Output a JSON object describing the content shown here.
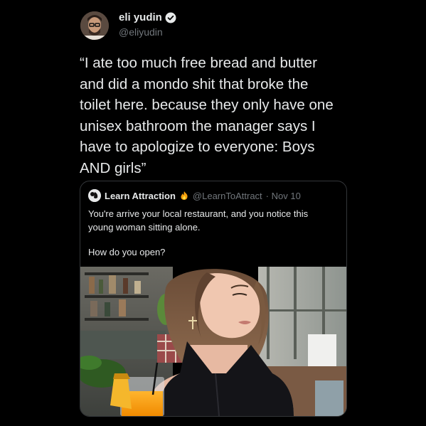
{
  "tweet": {
    "author_name": "eli yudin",
    "author_handle": "@eliyudin",
    "text_lines": [
      "“I ate too much free bread and butter",
      "and did a mondo shit that broke the",
      "toilet here. because they only have one",
      "unisex bathroom the manager says I",
      "have to apologize to everyone: Boys",
      "AND girls”"
    ]
  },
  "quoted": {
    "author_name": "Learn Attraction",
    "author_handle": "@LearnToAttract",
    "date": "· Nov 10",
    "text_lines": [
      "You're arrive your local restaurant, and you notice this",
      "young woman sitting alone."
    ],
    "text_question": "How do you open?"
  },
  "icons": {
    "verified": "verified-badge-icon",
    "fire": "fire-emoji-icon"
  },
  "colors": {
    "background": "#000000",
    "primary_text": "#e7e9ea",
    "secondary_text": "#71767b",
    "border": "#333639"
  }
}
